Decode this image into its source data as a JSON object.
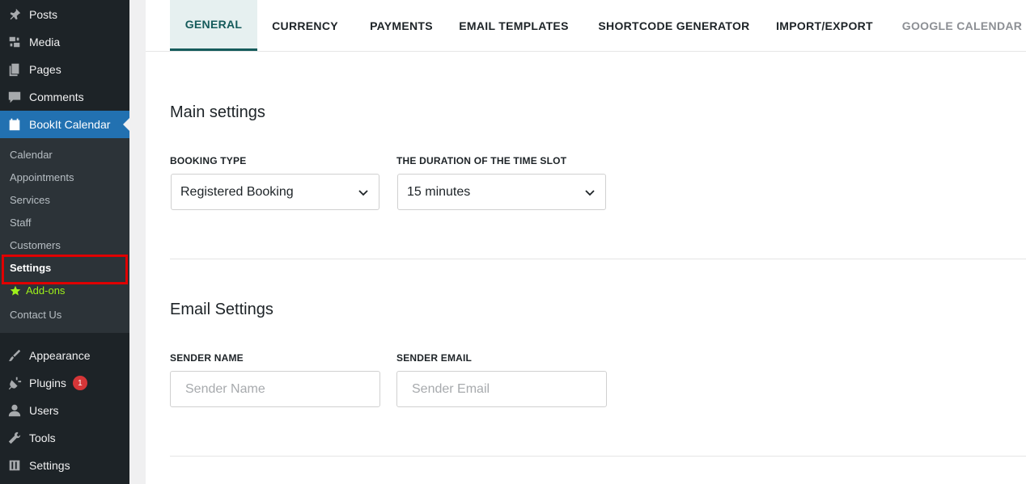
{
  "sidebar": {
    "top_items": [
      {
        "label": "Posts",
        "icon": "pin-icon"
      },
      {
        "label": "Media",
        "icon": "media-icon"
      },
      {
        "label": "Pages",
        "icon": "pages-icon"
      },
      {
        "label": "Comments",
        "icon": "comment-icon"
      },
      {
        "label": "BookIt Calendar",
        "icon": "calendar-icon"
      }
    ],
    "submenu": [
      "Calendar",
      "Appointments",
      "Services",
      "Staff",
      "Customers",
      "Settings",
      "Add-ons",
      "Contact Us"
    ],
    "bottom_items": [
      {
        "label": "Appearance",
        "icon": "brush-icon"
      },
      {
        "label": "Plugins",
        "icon": "plugin-icon",
        "badge": "1"
      },
      {
        "label": "Users",
        "icon": "user-icon"
      },
      {
        "label": "Tools",
        "icon": "wrench-icon"
      },
      {
        "label": "Settings",
        "icon": "settings-icon"
      }
    ]
  },
  "tabs": [
    "GENERAL",
    "CURRENCY",
    "PAYMENTS",
    "EMAIL TEMPLATES",
    "SHORTCODE GENERATOR",
    "IMPORT/EXPORT",
    "GOOGLE CALENDAR"
  ],
  "main_settings": {
    "title": "Main settings",
    "booking_type_label": "BOOKING TYPE",
    "booking_type_value": "Registered Booking",
    "duration_label": "THE DURATION OF THE TIME SLOT",
    "duration_value": "15 minutes"
  },
  "email_settings": {
    "title": "Email Settings",
    "sender_name_label": "SENDER NAME",
    "sender_name_placeholder": "Sender Name",
    "sender_email_label": "SENDER EMAIL",
    "sender_email_placeholder": "Sender Email"
  },
  "colors": {
    "sidebar_bg": "#1d2327",
    "active_menu": "#2271b1",
    "active_tab": "#155b5b",
    "addons": "#9ef01a",
    "highlight": "#e00000",
    "badge": "#d63638"
  }
}
